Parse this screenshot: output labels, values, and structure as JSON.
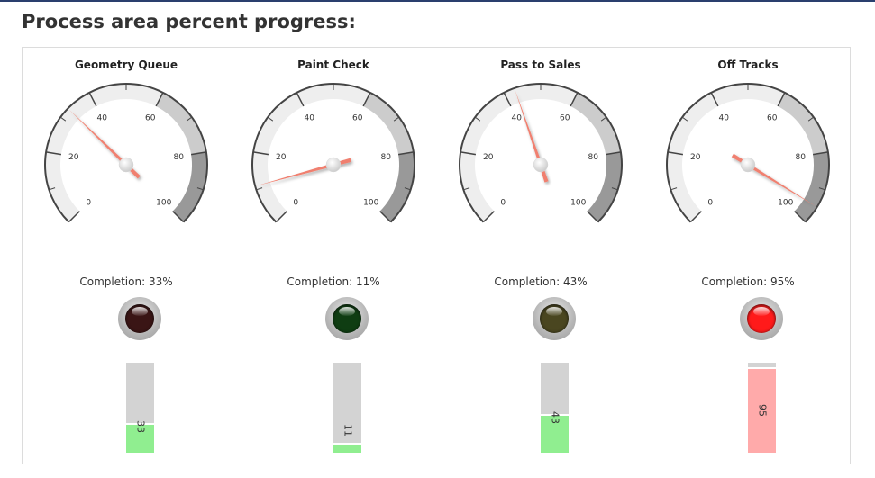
{
  "page": {
    "title": "Process area percent progress:"
  },
  "gauge_config": {
    "min": 0,
    "max": 100,
    "major_ticks": [
      0,
      20,
      40,
      60,
      80,
      100
    ],
    "bands": [
      {
        "from": 0,
        "to": 60,
        "color": "#eeeeee"
      },
      {
        "from": 60,
        "to": 80,
        "color": "#cccccc"
      },
      {
        "from": 80,
        "to": 100,
        "color": "#999999"
      }
    ],
    "needle_color": "#f08070"
  },
  "areas": [
    {
      "name": "Geometry Queue",
      "completion_label": "Completion: 33%",
      "value": 33,
      "bar_label": "33",
      "lamp_color": "#3a1515",
      "bar_fill_color": "#90ee90",
      "bar_track_color": "#d3d3d3"
    },
    {
      "name": "Paint Check",
      "completion_label": "Completion: 11%",
      "value": 11,
      "bar_label": "11",
      "lamp_color": "#0f3d12",
      "bar_fill_color": "#90ee90",
      "bar_track_color": "#d3d3d3"
    },
    {
      "name": "Pass to Sales",
      "completion_label": "Completion: 43%",
      "value": 43,
      "bar_label": "43",
      "lamp_color": "#4a4620",
      "bar_fill_color": "#90ee90",
      "bar_track_color": "#d3d3d3"
    },
    {
      "name": "Off Tracks",
      "completion_label": "Completion: 95%",
      "value": 95,
      "bar_label": "95",
      "lamp_color": "#ff1a1a",
      "bar_fill_color": "#ffaaaa",
      "bar_track_color": "#d3d3d3"
    }
  ]
}
